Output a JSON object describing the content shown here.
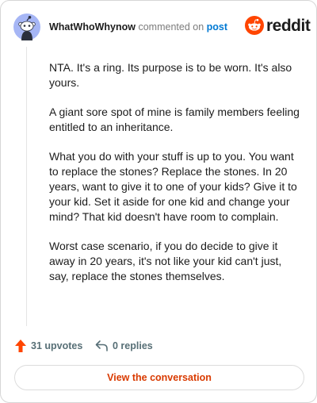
{
  "header": {
    "username": "WhatWhoWhynow",
    "action_text": "commented on",
    "post_link": "post",
    "logo_word": "reddit"
  },
  "comment": {
    "paragraphs": [
      "NTA. It's a ring. Its purpose is to be worn. It's also yours.",
      "A giant sore spot of mine is family members feeling entitled to an inheritance.",
      "What you do with your stuff is up to you. You want to replace the stones? Replace the stones. In 20 years, want to give it to one of your kids? Give it to your kid. Set it aside for one kid and change your mind? That kid doesn't have room to complain.",
      "Worst case scenario, if you do decide to give it away in 20 years, it's not like your kid can't just, say, replace the stones themselves."
    ]
  },
  "footer": {
    "upvotes_label": "31 upvotes",
    "replies_label": "0 replies",
    "view_button": "View the conversation"
  },
  "colors": {
    "brand": "#ff4500",
    "link": "#0079d3",
    "button_text": "#d93a00",
    "meta_text": "#576f76"
  },
  "icons": {
    "avatar": "snoo-avatar-icon",
    "logo": "reddit-snoo-icon",
    "upvote": "upvote-arrow-icon",
    "reply": "reply-arrow-icon"
  }
}
